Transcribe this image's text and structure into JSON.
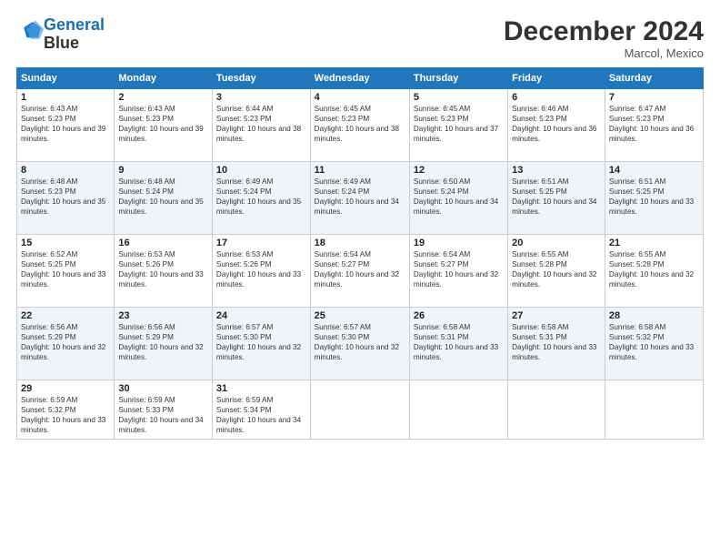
{
  "header": {
    "logo_line1": "General",
    "logo_line2": "Blue",
    "month_title": "December 2024",
    "location": "Marcol, Mexico"
  },
  "weekdays": [
    "Sunday",
    "Monday",
    "Tuesday",
    "Wednesday",
    "Thursday",
    "Friday",
    "Saturday"
  ],
  "weeks": [
    [
      {
        "day": "1",
        "sunrise": "6:43 AM",
        "sunset": "5:23 PM",
        "daylight": "10 hours and 39 minutes."
      },
      {
        "day": "2",
        "sunrise": "6:43 AM",
        "sunset": "5:23 PM",
        "daylight": "10 hours and 39 minutes."
      },
      {
        "day": "3",
        "sunrise": "6:44 AM",
        "sunset": "5:23 PM",
        "daylight": "10 hours and 38 minutes."
      },
      {
        "day": "4",
        "sunrise": "6:45 AM",
        "sunset": "5:23 PM",
        "daylight": "10 hours and 38 minutes."
      },
      {
        "day": "5",
        "sunrise": "6:45 AM",
        "sunset": "5:23 PM",
        "daylight": "10 hours and 37 minutes."
      },
      {
        "day": "6",
        "sunrise": "6:46 AM",
        "sunset": "5:23 PM",
        "daylight": "10 hours and 36 minutes."
      },
      {
        "day": "7",
        "sunrise": "6:47 AM",
        "sunset": "5:23 PM",
        "daylight": "10 hours and 36 minutes."
      }
    ],
    [
      {
        "day": "8",
        "sunrise": "6:48 AM",
        "sunset": "5:23 PM",
        "daylight": "10 hours and 35 minutes."
      },
      {
        "day": "9",
        "sunrise": "6:48 AM",
        "sunset": "5:24 PM",
        "daylight": "10 hours and 35 minutes."
      },
      {
        "day": "10",
        "sunrise": "6:49 AM",
        "sunset": "5:24 PM",
        "daylight": "10 hours and 35 minutes."
      },
      {
        "day": "11",
        "sunrise": "6:49 AM",
        "sunset": "5:24 PM",
        "daylight": "10 hours and 34 minutes."
      },
      {
        "day": "12",
        "sunrise": "6:50 AM",
        "sunset": "5:24 PM",
        "daylight": "10 hours and 34 minutes."
      },
      {
        "day": "13",
        "sunrise": "6:51 AM",
        "sunset": "5:25 PM",
        "daylight": "10 hours and 34 minutes."
      },
      {
        "day": "14",
        "sunrise": "6:51 AM",
        "sunset": "5:25 PM",
        "daylight": "10 hours and 33 minutes."
      }
    ],
    [
      {
        "day": "15",
        "sunrise": "6:52 AM",
        "sunset": "5:25 PM",
        "daylight": "10 hours and 33 minutes."
      },
      {
        "day": "16",
        "sunrise": "6:53 AM",
        "sunset": "5:26 PM",
        "daylight": "10 hours and 33 minutes."
      },
      {
        "day": "17",
        "sunrise": "6:53 AM",
        "sunset": "5:26 PM",
        "daylight": "10 hours and 33 minutes."
      },
      {
        "day": "18",
        "sunrise": "6:54 AM",
        "sunset": "5:27 PM",
        "daylight": "10 hours and 32 minutes."
      },
      {
        "day": "19",
        "sunrise": "6:54 AM",
        "sunset": "5:27 PM",
        "daylight": "10 hours and 32 minutes."
      },
      {
        "day": "20",
        "sunrise": "6:55 AM",
        "sunset": "5:28 PM",
        "daylight": "10 hours and 32 minutes."
      },
      {
        "day": "21",
        "sunrise": "6:55 AM",
        "sunset": "5:28 PM",
        "daylight": "10 hours and 32 minutes."
      }
    ],
    [
      {
        "day": "22",
        "sunrise": "6:56 AM",
        "sunset": "5:29 PM",
        "daylight": "10 hours and 32 minutes."
      },
      {
        "day": "23",
        "sunrise": "6:56 AM",
        "sunset": "5:29 PM",
        "daylight": "10 hours and 32 minutes."
      },
      {
        "day": "24",
        "sunrise": "6:57 AM",
        "sunset": "5:30 PM",
        "daylight": "10 hours and 32 minutes."
      },
      {
        "day": "25",
        "sunrise": "6:57 AM",
        "sunset": "5:30 PM",
        "daylight": "10 hours and 32 minutes."
      },
      {
        "day": "26",
        "sunrise": "6:58 AM",
        "sunset": "5:31 PM",
        "daylight": "10 hours and 33 minutes."
      },
      {
        "day": "27",
        "sunrise": "6:58 AM",
        "sunset": "5:31 PM",
        "daylight": "10 hours and 33 minutes."
      },
      {
        "day": "28",
        "sunrise": "6:58 AM",
        "sunset": "5:32 PM",
        "daylight": "10 hours and 33 minutes."
      }
    ],
    [
      {
        "day": "29",
        "sunrise": "6:59 AM",
        "sunset": "5:32 PM",
        "daylight": "10 hours and 33 minutes."
      },
      {
        "day": "30",
        "sunrise": "6:59 AM",
        "sunset": "5:33 PM",
        "daylight": "10 hours and 34 minutes."
      },
      {
        "day": "31",
        "sunrise": "6:59 AM",
        "sunset": "5:34 PM",
        "daylight": "10 hours and 34 minutes."
      },
      null,
      null,
      null,
      null
    ]
  ]
}
